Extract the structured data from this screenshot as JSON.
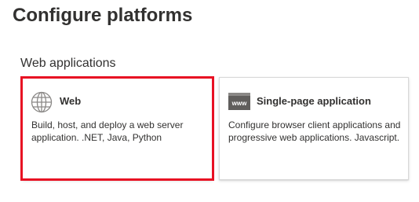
{
  "page": {
    "title": "Configure platforms"
  },
  "section": {
    "label": "Web applications"
  },
  "cards": [
    {
      "title": "Web",
      "description": "Build, host, and deploy a web server application. .NET, Java, Python",
      "icon": "globe-icon",
      "selected": true
    },
    {
      "title": "Single-page application",
      "description": "Configure browser client applications and progressive web applications. Javascript.",
      "icon": "www-browser-icon",
      "icon_text": "www",
      "selected": false
    }
  ],
  "colors": {
    "highlight": "#e81123",
    "card_border": "#d8d8d8",
    "text": "#323130",
    "icon_dark": "#605e5c"
  }
}
